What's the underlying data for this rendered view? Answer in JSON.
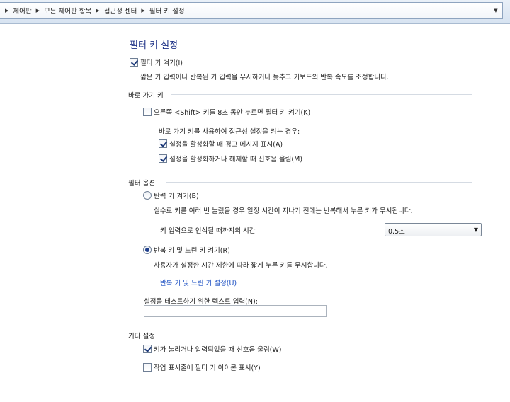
{
  "breadcrumb": {
    "items": [
      "제어판",
      "모든 제어판 항목",
      "접근성 센터",
      "필터 키 설정"
    ]
  },
  "page_title": "필터 키 설정",
  "enable_filter": {
    "label": "필터 키 켜기(I)",
    "checked": true,
    "description": "짧은 키 입력이나 반복된 키 입력을 무시하거나 늦추고 키보드의 반복 속도를 조정합니다."
  },
  "shortcut": {
    "section_label": "바로 가기 키",
    "right_shift": {
      "label": "오른쪽 <Shift> 키를 8초 동안 누르면 필터 키 켜기(K)",
      "checked": false
    },
    "note": "바로 가기 키를 사용하여 접근성 설정을 켜는 경우:",
    "warn": {
      "label": "설정을 활성화할 때 경고 메시지 표시(A)",
      "checked": true
    },
    "sound": {
      "label": "설정을 활성화하거나 해제할 때 신호음 울림(M)",
      "checked": true
    }
  },
  "filter_options": {
    "section_label": "필터 옵션",
    "bounce": {
      "label": "탄력 키 켜기(B)",
      "selected": false,
      "description": "실수로 키를 여러 번 눌렀을 경우 일정 시간이 지나기 전에는 반복해서 누른 키가 무시됩니다."
    },
    "delay_label": "키 입력으로 인식될 때까지의 시간",
    "delay_value": "0.5초",
    "repeat": {
      "label": "반복 키 및 느린 키 켜기(R)",
      "selected": true,
      "description": "사용자가 설정한 시간 제한에 따라 짧게 누른 키를 무시합니다.",
      "link": "반복 키 및 느린 키 설정(U)"
    },
    "test_label": "설정을 테스트하기 위한 텍스트 입력(N):",
    "test_value": ""
  },
  "other": {
    "section_label": "기타 설정",
    "beep": {
      "label": "키가 눌리거나 입력되었을 때 신호음 울림(W)",
      "checked": true
    },
    "tray_icon": {
      "label": "작업 표시줄에 필터 키 아이콘 표시(Y)",
      "checked": false
    }
  }
}
